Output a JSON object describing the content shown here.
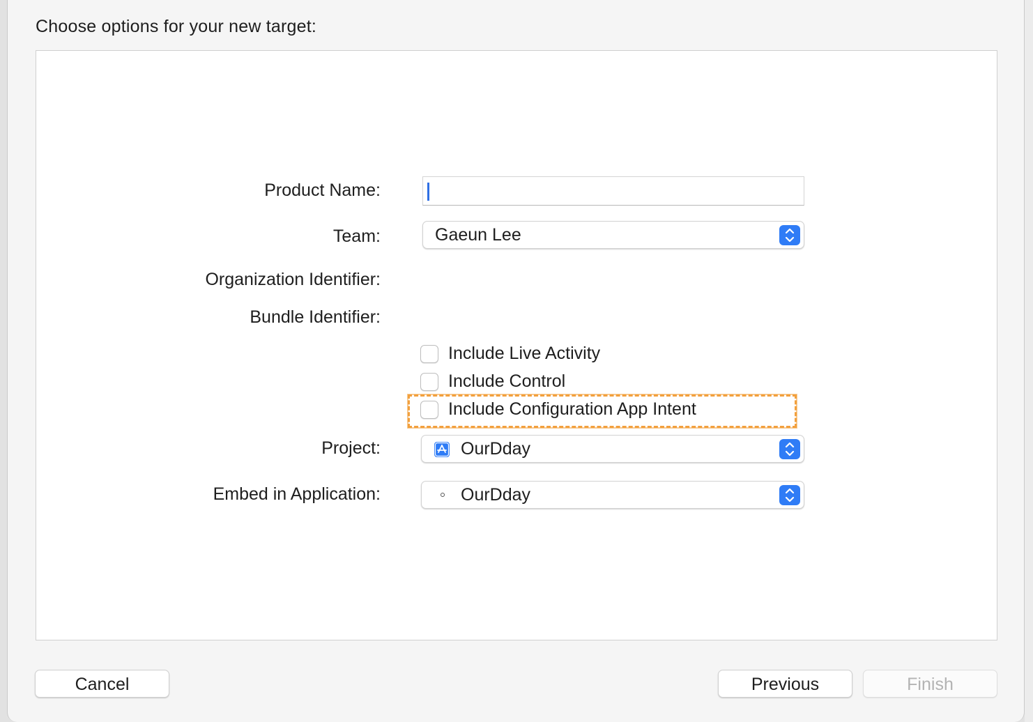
{
  "sheet": {
    "title": "Choose options for your new target:"
  },
  "form": {
    "product_name": {
      "label": "Product Name:",
      "value": ""
    },
    "team": {
      "label": "Team:",
      "value": "Gaeun Lee"
    },
    "organization_identifier": {
      "label": "Organization Identifier:"
    },
    "bundle_identifier": {
      "label": "Bundle Identifier:"
    },
    "checkboxes": [
      {
        "label": "Include Live Activity",
        "checked": false
      },
      {
        "label": "Include Control",
        "checked": false
      },
      {
        "label": "Include Configuration App Intent",
        "checked": false,
        "highlighted": true
      }
    ],
    "project": {
      "label": "Project:",
      "value": "OurDday",
      "icon": "app-store-icon"
    },
    "embed_in_application": {
      "label": "Embed in Application:",
      "value": "OurDday",
      "icon": "dot-icon"
    }
  },
  "buttons": {
    "cancel": "Cancel",
    "previous": "Previous",
    "finish": "Finish"
  },
  "colors": {
    "accent": "#2f7cf6",
    "highlight": "#f2a03d",
    "disabled_text": "#b3b3b3"
  }
}
